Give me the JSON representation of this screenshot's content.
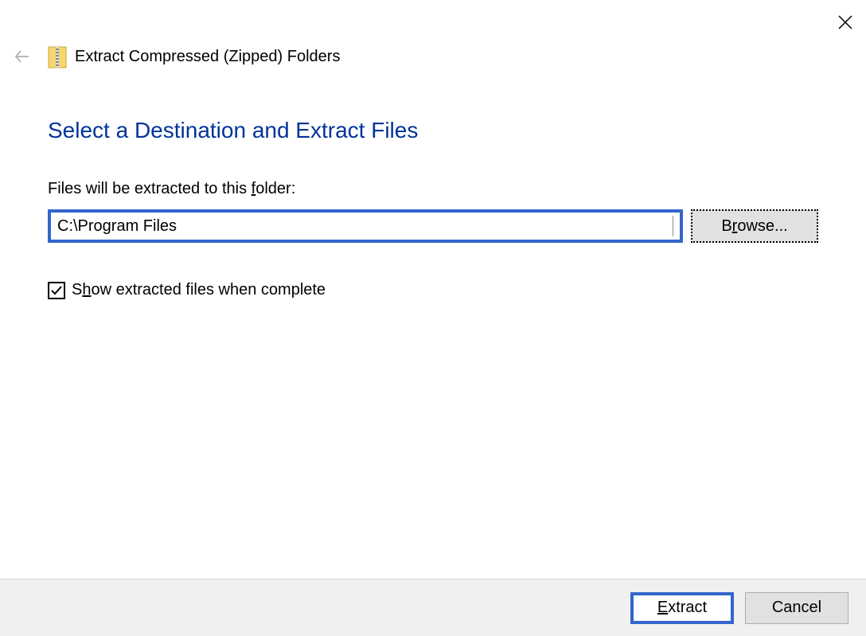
{
  "window": {
    "title": "Extract Compressed (Zipped) Folders"
  },
  "heading": "Select a Destination and Extract Files",
  "folder_label_pre": "Files will be extracted to this ",
  "folder_label_key": "f",
  "folder_label_post": "older:",
  "path_value": "C:\\Program Files",
  "browse_pre": "B",
  "browse_key": "r",
  "browse_post": "owse...",
  "checkbox": {
    "checked": true,
    "label_pre": "S",
    "label_key": "h",
    "label_post": "ow extracted files when complete"
  },
  "buttons": {
    "extract_key": "E",
    "extract_post": "xtract",
    "cancel": "Cancel"
  }
}
